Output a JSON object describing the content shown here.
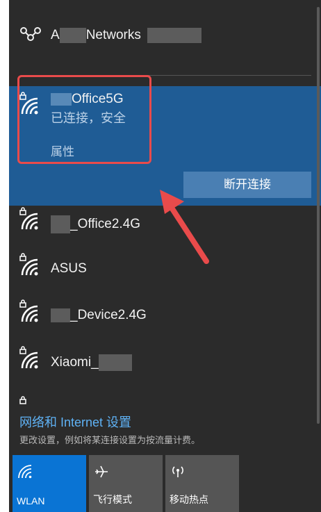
{
  "header": {
    "title_prefix": "A",
    "title_main": "Networks"
  },
  "connected": {
    "ssid": "Office5G",
    "status": "已连接，安全",
    "properties_label": "属性",
    "disconnect_label": "断开连接"
  },
  "networks": [
    {
      "ssid": "_Office2.4G"
    },
    {
      "ssid": "ASUS"
    },
    {
      "ssid": "_Device2.4G"
    },
    {
      "ssid": "Xiaomi_"
    }
  ],
  "settings": {
    "link": "网络和 Internet 设置",
    "description": "更改设置，例如将某连接设置为按流量计费。"
  },
  "quick_actions": [
    {
      "label": "WLAN",
      "icon": "wifi-icon",
      "active": true
    },
    {
      "label": "飞行模式",
      "icon": "airplane-icon",
      "active": false
    },
    {
      "label": "移动热点",
      "icon": "hotspot-icon",
      "active": false
    }
  ],
  "colors": {
    "panel_bg": "#2b2b2b",
    "selected_bg": "#1f5c95",
    "accent": "#0a74d4",
    "link": "#5fb2f5",
    "annotation": "#e94b4b"
  }
}
